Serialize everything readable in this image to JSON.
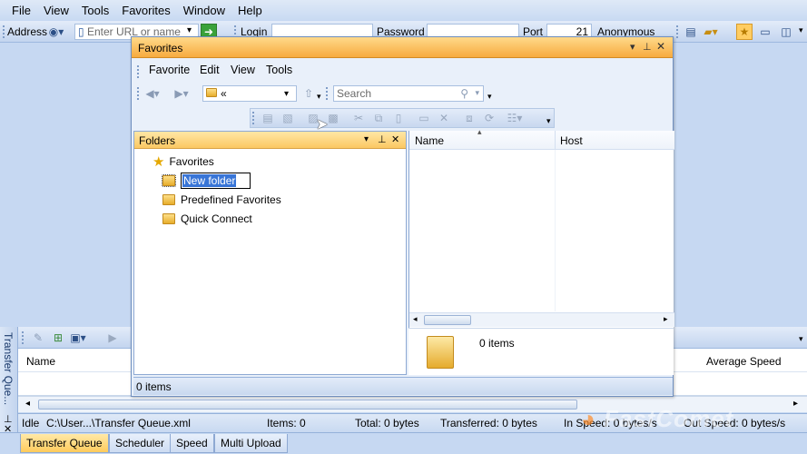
{
  "menu": [
    "File",
    "View",
    "Tools",
    "Favorites",
    "Window",
    "Help"
  ],
  "toolbar": {
    "address_label": "Address",
    "url_placeholder": "Enter URL or name",
    "login_label": "Login",
    "password_label": "Password",
    "port_label": "Port",
    "port_value": "21",
    "anonymous_label": "Anonymous"
  },
  "favorites_window": {
    "title": "Favorites",
    "menu": [
      "Favorite",
      "Edit",
      "View",
      "Tools"
    ],
    "path_value": "«",
    "search_placeholder": "Search",
    "folders_title": "Folders",
    "tree": {
      "root": "Favorites",
      "editing_item": "New folder",
      "items": [
        "Predefined Favorites",
        "Quick Connect"
      ]
    },
    "columns": [
      "Name",
      "Host"
    ],
    "preview_count": "0 items",
    "status": "0 items"
  },
  "transfer_queue": {
    "side_label": "Transfer Que...",
    "columns": [
      "Name",
      "Average Speed"
    ],
    "status": {
      "state": "Idle",
      "path": "C:\\User...\\Transfer Queue.xml",
      "items": "Items: 0",
      "total": "Total: 0 bytes",
      "transferred": "Transferred: 0 bytes",
      "in_speed": "In Speed: 0 bytes/s",
      "out_speed": "Out Speed: 0 bytes/s"
    }
  },
  "bottom_tabs": [
    "Transfer Queue",
    "Scheduler",
    "Speed",
    "Multi Upload"
  ],
  "watermark": "FastComet",
  "colors": {
    "accent": "#f7ab3f",
    "frame": "#c6d8f2",
    "selection": "#3875d7"
  }
}
